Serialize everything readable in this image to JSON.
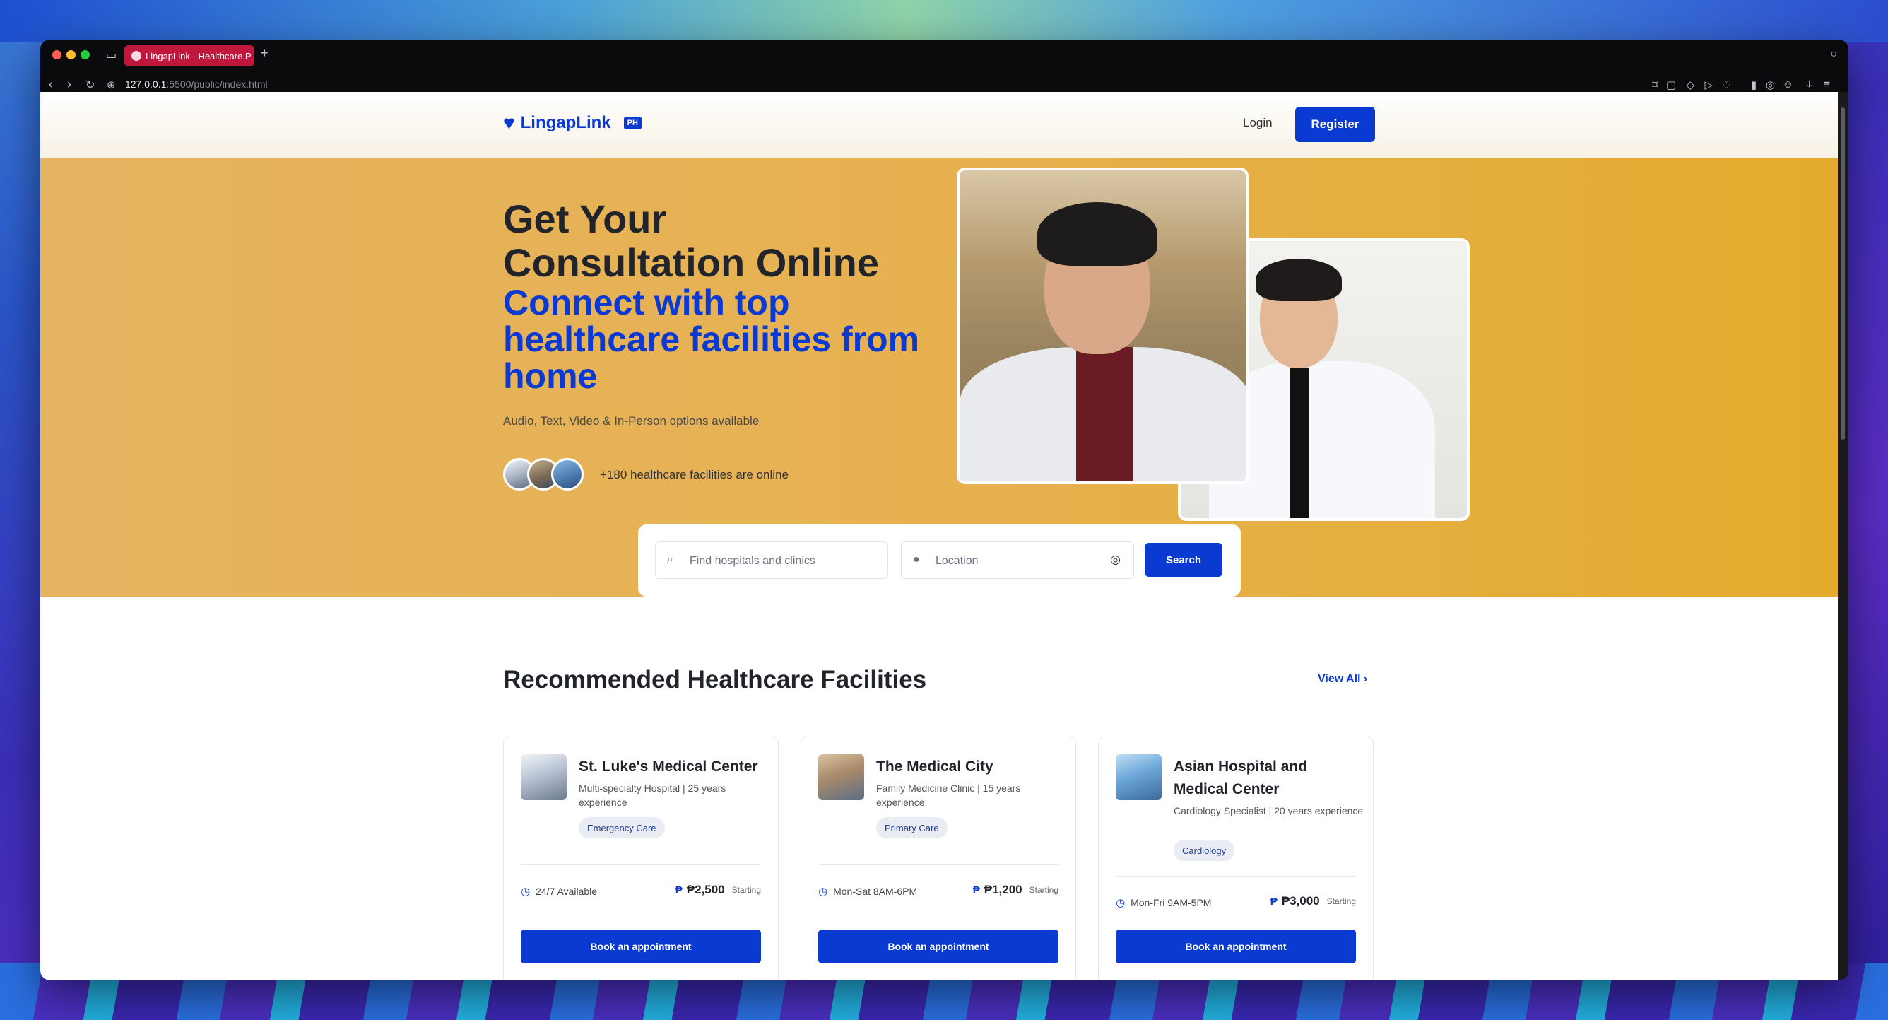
{
  "browser": {
    "tab_title": "LingapLink - Healthcare P",
    "url_host": "127.0.0.1",
    "url_rest": ":5500/public/index.html"
  },
  "header": {
    "logo_text": "LingapLink",
    "logo_badge": "PH",
    "login_label": "Login",
    "register_label": "Register"
  },
  "hero": {
    "title": "Get Your Consultation Online",
    "subtitle": "Connect with top healthcare facilities from home",
    "description": "Audio, Text, Video & In-Person options available",
    "facilities_online": "+180 healthcare facilities are online"
  },
  "search": {
    "facility_placeholder": "Find hospitals and clinics",
    "location_placeholder": "Location",
    "button_label": "Search"
  },
  "recommended": {
    "title": "Recommended Healthcare Facilities",
    "view_all_label": "View All",
    "cards": [
      {
        "name": "St. Luke's Medical Center",
        "subtitle": "Multi-specialty Hospital | 25 years experience",
        "tag": "Emergency Care",
        "availability": "24/7 Available",
        "price": "₱2,500",
        "price_note": "Starting",
        "button": "Book an appointment"
      },
      {
        "name": "The Medical City",
        "subtitle": "Family Medicine Clinic | 15 years experience",
        "tag": "Primary Care",
        "availability": "Mon-Sat 8AM-6PM",
        "price": "₱1,200",
        "price_note": "Starting",
        "button": "Book an appointment"
      },
      {
        "name": "Asian Hospital and Medical Center",
        "subtitle": "Cardiology Specialist | 20 years experience",
        "tag": "Cardiology",
        "availability": "Mon-Fri 9AM-5PM",
        "price": "₱3,000",
        "price_note": "Starting",
        "button": "Book an appointment"
      }
    ]
  },
  "colors": {
    "brand": "#0a3ad1",
    "hero_bg": "#e7b150",
    "tab_active": "#c0183c"
  }
}
